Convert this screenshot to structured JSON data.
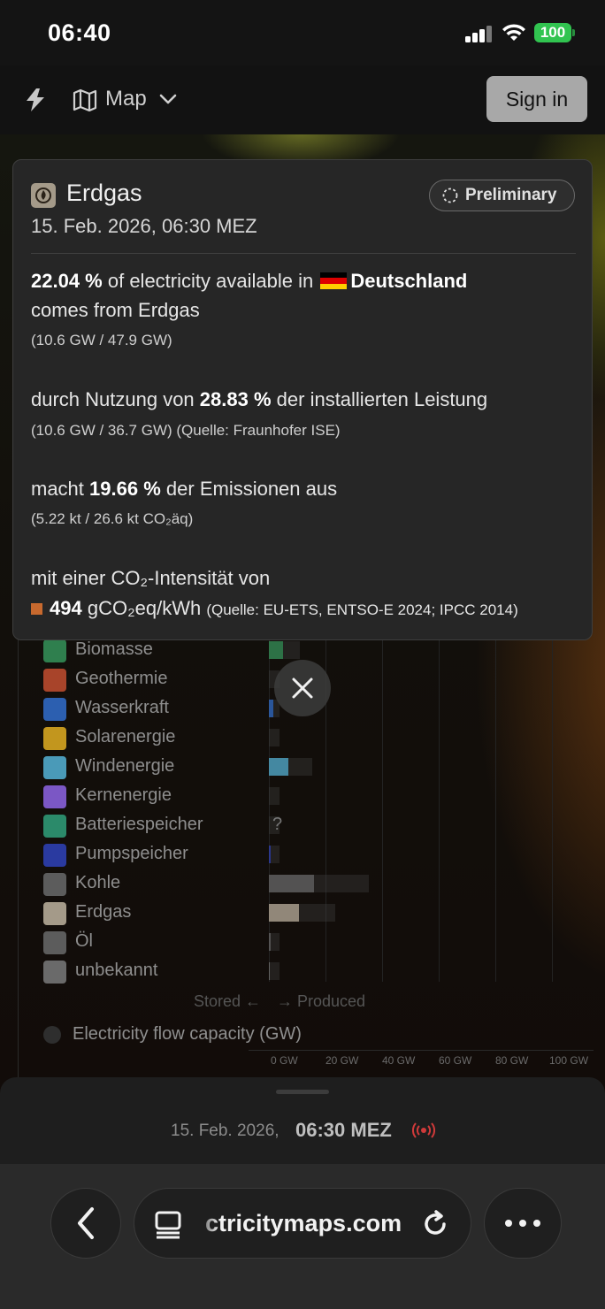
{
  "status_bar": {
    "time": "06:40",
    "battery": "100"
  },
  "header": {
    "view_label": "Map",
    "sign_in_label": "Sign in"
  },
  "tooltip": {
    "title": "Erdgas",
    "date": "15. Feb. 2026, 06:30 MEZ",
    "badge": "Preliminary",
    "share": {
      "percent": "22.04 %",
      "text_before_country": "of electricity available in",
      "country": "Deutschland",
      "text_after": "comes from Erdgas",
      "detail": "(10.6 GW / 47.9 GW)"
    },
    "capacity": {
      "prefix": "durch Nutzung von",
      "percent": "28.83 %",
      "suffix": "der installierten Leistung",
      "detail": "(10.6 GW / 36.7 GW) (Quelle: Fraunhofer ISE)"
    },
    "emissions": {
      "prefix": "macht",
      "percent": "19.66 %",
      "suffix": "der Emissionen aus",
      "detail": "(5.22 kt / 26.6 kt CO₂äq)"
    },
    "intensity": {
      "prefix": "mit einer CO₂-Intensität von",
      "value": "494",
      "unit": "gCO₂eq/kWh",
      "source": "(Quelle: EU-ETS, ENTSO-E 2024; IPCC 2014)",
      "color": "#c7692e"
    }
  },
  "production_list": [
    {
      "label": "Biomasse",
      "icon": "sprout-icon",
      "color": "#2f7f4e",
      "produced_gw": 5
    },
    {
      "label": "Geothermie",
      "icon": "heat-waves-icon",
      "color": "#a8442a",
      "produced_gw": 0
    },
    {
      "label": "Wasserkraft",
      "icon": "water-waves-icon",
      "color": "#2c5fb0",
      "produced_gw": 1.5
    },
    {
      "label": "Solarenergie",
      "icon": "sun-gear-icon",
      "color": "#c2961e",
      "produced_gw": 0
    },
    {
      "label": "Windenergie",
      "icon": "wind-icon",
      "color": "#4a9ab8",
      "produced_gw": 7
    },
    {
      "label": "Kernenergie",
      "icon": "atom-icon",
      "color": "#7b57c5",
      "produced_gw": 0
    },
    {
      "label": "Batteriespeicher",
      "icon": "battery-icon",
      "color": "#2b8a6a",
      "produced_gw": 0,
      "unknown": "?"
    },
    {
      "label": "Pumpspeicher",
      "icon": "pump-storage-icon",
      "color": "#2a3aa0",
      "produced_gw": 0.5
    },
    {
      "label": "Kohle",
      "icon": "coal-drop-icon",
      "color": "#5c5c5c",
      "produced_gw": 16
    },
    {
      "label": "Erdgas",
      "icon": "gas-flame-icon",
      "color": "#a49a89",
      "produced_gw": 10.6
    },
    {
      "label": "Öl",
      "icon": "oil-drop-icon",
      "color": "#5c5c5c",
      "produced_gw": 0.5
    },
    {
      "label": "unbekannt",
      "icon": "question-icon",
      "color": "#6a6a6a",
      "produced_gw": 0.3
    }
  ],
  "axis": {
    "stored_label": "Stored ←",
    "produced_label": "→ Produced",
    "ticks": [
      "0 GW",
      "20 GW",
      "40 GW",
      "60 GW",
      "80 GW",
      "100 GW"
    ]
  },
  "flow_label": "Electricity flow capacity (GW)",
  "sheet": {
    "date": "15. Feb. 2026,",
    "time": "06:30 MEZ"
  },
  "browser": {
    "url": "ctricitymaps.com"
  }
}
